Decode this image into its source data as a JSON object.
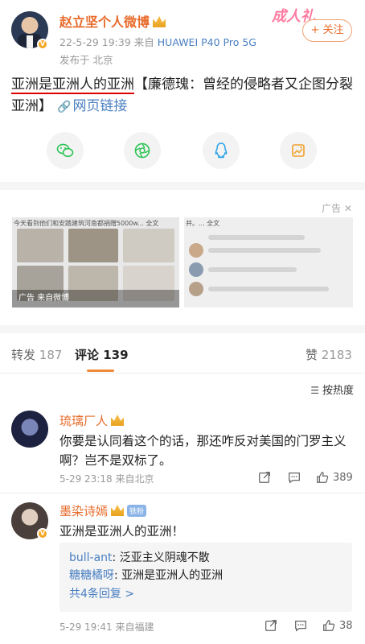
{
  "post": {
    "username": "赵立坚个人微博",
    "date": "22-5-29 19:39",
    "source_prefix": "来自",
    "device": "HUAWEI P40 Pro 5G",
    "location": "发布于 北京",
    "watermark": "成人礼",
    "follow_label": "+ 关注",
    "text_underlined": "亚洲是亚洲人的亚洲",
    "text_rest": "【廉德瑰：曾经的侵略者又企图分裂亚洲】",
    "link_label": "网页链接"
  },
  "share": {
    "icons": [
      "wechat-icon",
      "moments-icon",
      "qq-icon",
      "qzone-icon"
    ]
  },
  "ad": {
    "label": "广告",
    "caption_left": "今天看到他们和安踏建筑河南都捐赠5000w... 全文",
    "caption_right": "并。... 全文",
    "overlay": "广告 来自微博"
  },
  "tabs": {
    "repost_label": "转发",
    "repost_count": "187",
    "comment_label": "评论",
    "comment_count": "139",
    "like_label": "赞",
    "like_count": "2183"
  },
  "sort": {
    "label": "按热度"
  },
  "comments": [
    {
      "name": "琉璃厂人",
      "text": "你要是认同着这个的话，那还咋反对美国的门罗主义啊？岂不是双标了。",
      "meta": "5-29 23:18 来自北京",
      "likes": "389"
    },
    {
      "name": "墨染诗嫣",
      "badge": "铁粉",
      "text": "亚洲是亚洲人的亚洲！",
      "meta": "5-29 19:41 来自福建",
      "likes": "38",
      "replies": [
        {
          "name": "bull-ant",
          "text": ": 泛亚主义阴魂不散"
        },
        {
          "name": "糖糖橘呀",
          "text": ": 亚洲是亚洲人的亚洲"
        }
      ],
      "more_replies": "共4条回复 >"
    }
  ]
}
